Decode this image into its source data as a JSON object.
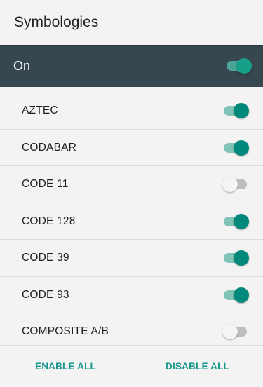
{
  "header": {
    "title": "Symbologies"
  },
  "master": {
    "label": "On",
    "enabled": true
  },
  "symbologies": [
    {
      "label": "AZTEC",
      "enabled": true
    },
    {
      "label": "CODABAR",
      "enabled": true
    },
    {
      "label": "CODE 11",
      "enabled": false
    },
    {
      "label": "CODE 128",
      "enabled": true
    },
    {
      "label": "CODE 39",
      "enabled": true
    },
    {
      "label": "CODE 93",
      "enabled": true
    },
    {
      "label": "COMPOSITE A/B",
      "enabled": false
    }
  ],
  "footer": {
    "enable_all": "ENABLE ALL",
    "disable_all": "DISABLE ALL"
  },
  "colors": {
    "accent": "#00897b",
    "master_bar": "#37474f"
  }
}
